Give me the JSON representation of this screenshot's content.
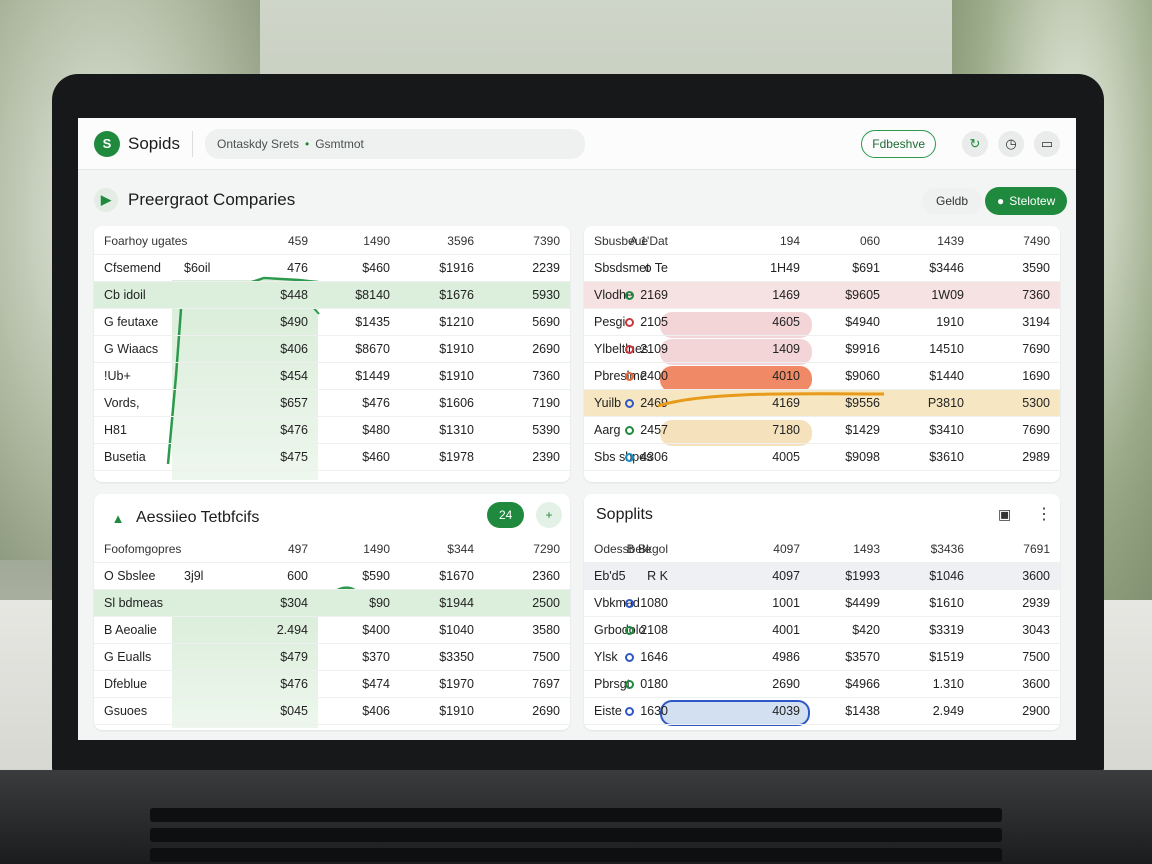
{
  "app": {
    "name": "Sopids",
    "logo_glyph": "S"
  },
  "breadcrumb": {
    "first": "Ontaskdy Srets",
    "separator": "•",
    "second": "Gsmtmot"
  },
  "topbar": {
    "outline_button": "Fdbeshve",
    "icons": [
      "refresh-icon",
      "clock-icon",
      "chat-icon"
    ]
  },
  "section1": {
    "title": "Preergraot Comparies",
    "button_light": "Geldb",
    "button_green": "Stelotew"
  },
  "panel_a": {
    "header": [
      "Foarhoy ugates",
      "459",
      "1490",
      "3596",
      "7390"
    ],
    "rows": [
      [
        "Cfsemend",
        "476",
        "$460",
        "$1916",
        "2239"
      ],
      [
        "Cb idoil",
        "$448",
        "$8140",
        "$1676",
        "5930"
      ],
      [
        "G feutaxe",
        "$490",
        "$1435",
        "$1210",
        "5690"
      ],
      [
        "G Wiaacs",
        "$406",
        "$8670",
        "$1910",
        "2690"
      ],
      [
        "!Ub+",
        "$454",
        "$1449",
        "$1910",
        "7360"
      ],
      [
        "Vords,",
        "$657",
        "$476",
        "$1606",
        "7190"
      ],
      [
        "H81",
        "$476",
        "$480",
        "$1310",
        "5390"
      ],
      [
        "Busetia",
        "$475",
        "$460",
        "$1978",
        "2390"
      ]
    ],
    "chart_label": "$6oil"
  },
  "panel_b": {
    "header": [
      "Sbusbeue",
      "A 1'Dat",
      "194",
      "060",
      "1439",
      "7490"
    ],
    "rows": [
      [
        "Sbsdsmet",
        "o Te",
        "1H49",
        "$691",
        "$3446",
        "3590"
      ],
      [
        "Vlodhe",
        "2169",
        "1469",
        "$9605",
        "1W09",
        "7360"
      ],
      [
        "Pesgi",
        "2105",
        "4605",
        "$4940",
        "1910",
        "3194"
      ],
      [
        "Ylbeltlnes",
        "2109",
        "1409",
        "$9916",
        "14510",
        "7690"
      ],
      [
        "Pbreslme",
        "2400",
        "4010",
        "$9060",
        "$1440",
        "1690"
      ],
      [
        "Yuilb",
        "2469",
        "4169",
        "$9556",
        "P3810",
        "5300"
      ],
      [
        "Aarg",
        "2457",
        "7180",
        "$1429",
        "$3410",
        "7690"
      ],
      [
        "Sbs sbpes",
        "4306",
        "4005",
        "$9098",
        "$3610",
        "2989"
      ]
    ],
    "dot_colors": [
      "#1f8a3e",
      "#1f8a3e",
      "#c8383e",
      "#c8383e",
      "#e26a3c",
      "#2f58c6",
      "#1f8a3e",
      "#1a90c8"
    ]
  },
  "section2": {
    "title": "Aessiieo Tetbfcifs",
    "button_green": "24",
    "button_light": "+"
  },
  "panel_c": {
    "header": [
      "Foofomgopres",
      "497",
      "1490",
      "$344",
      "7290"
    ],
    "rows": [
      [
        "O Sbslee",
        "600",
        "$590",
        "$1670",
        "2360"
      ],
      [
        "Sl bdmeas",
        "$304",
        "$90",
        "$1944",
        "2500"
      ],
      [
        "B Aeoalie",
        "2.494",
        "$400",
        "$1040",
        "3580"
      ],
      [
        "G Eualls",
        "$479",
        "$370",
        "$3350",
        "7500"
      ],
      [
        "Dfeblue",
        "$476",
        "$474",
        "$1970",
        "7697"
      ],
      [
        "Gsuoes",
        "$045",
        "$406",
        "$1910",
        "2690"
      ]
    ],
    "chart_label": "3j9l"
  },
  "panel_d": {
    "title": "Sopplits",
    "header": [
      "Odessbele",
      "B Bkgol",
      "4097",
      "1493",
      "$3436",
      "7691"
    ],
    "rows": [
      [
        "Eb'd5",
        "R K",
        "4097",
        "$1993",
        "$1046",
        "3600"
      ],
      [
        "Vbkmad",
        "1080",
        "1001",
        "$4499",
        "$1610",
        "2939"
      ],
      [
        "Grbodolo",
        "2108",
        "4001",
        "$420",
        "$3319",
        "3043"
      ],
      [
        "Ylsk",
        "1646",
        "4986",
        "$3570",
        "$1519",
        "7500"
      ],
      [
        "Pbrsgt",
        "0180",
        "2690",
        "$4966",
        "1.310",
        "3600"
      ],
      [
        "Eiste",
        "1630",
        "4039",
        "$1438",
        "2.949",
        "2900"
      ]
    ],
    "dot_colors": [
      "",
      "#2f58c6",
      "#1f8a3e",
      "#2f58c6",
      "#1f8a3e",
      "#2f58c6"
    ]
  },
  "colors": {
    "accent": "#1f8a3e",
    "highlight_green": "#dcefdc",
    "highlight_pink": "#f6e1e3",
    "highlight_orange": "#f08a66",
    "highlight_yellow": "#f6e7c2",
    "highlight_blue": "#d3e0f2"
  }
}
